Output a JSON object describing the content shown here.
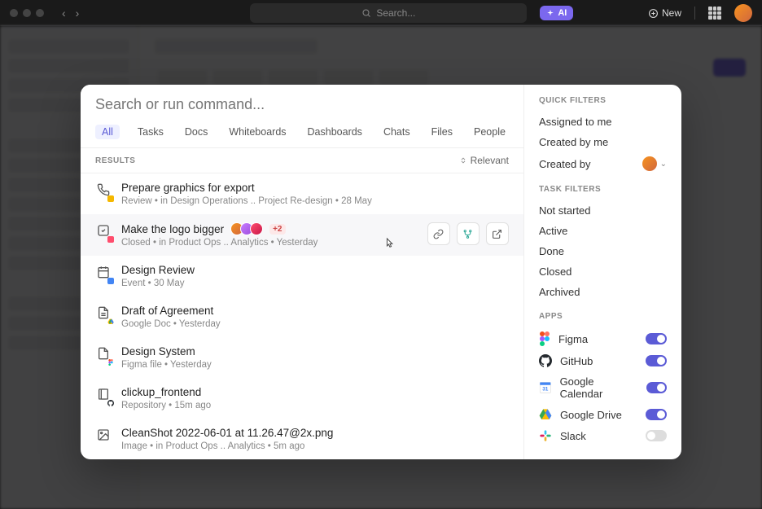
{
  "topbar": {
    "search_placeholder": "Search...",
    "ai_label": "AI",
    "new_label": "New"
  },
  "palette": {
    "search_placeholder": "Search or run command...",
    "tabs": [
      "All",
      "Tasks",
      "Docs",
      "Whiteboards",
      "Dashboards",
      "Chats",
      "Files",
      "People"
    ],
    "results_label": "RESULTS",
    "sort_label": "Relevant"
  },
  "results": [
    {
      "title": "Prepare graphics for export",
      "meta": "Review  •  in Design Operations ..   Project Re-design  •  28 May",
      "badge_color": "#f5b800"
    },
    {
      "title": "Make the logo bigger",
      "meta": "Closed  •  in Product Ops ..   Analytics  •  Yesterday",
      "extra_count": "+2",
      "badge_color": "#ff4d6d"
    },
    {
      "title": "Design Review",
      "meta": "Event  •  30 May"
    },
    {
      "title": "Draft of Agreement",
      "meta": "Google Doc  •  Yesterday"
    },
    {
      "title": "Design System",
      "meta": "Figma file  •  Yesterday"
    },
    {
      "title": "clickup_frontend",
      "meta": "Repository  •  15m ago"
    },
    {
      "title": "CleanShot 2022-06-01 at 11.26.47@2x.png",
      "meta": "Image  •  in Product Ops ..   Analytics  •  5m ago"
    }
  ],
  "sidebar": {
    "quick_filters_label": "QUICK FILTERS",
    "quick_filters": [
      "Assigned to me",
      "Created by me",
      "Created by"
    ],
    "task_filters_label": "TASK FILTERS",
    "task_filters": [
      "Not started",
      "Active",
      "Done",
      "Closed",
      "Archived"
    ],
    "apps_label": "APPS",
    "apps": [
      {
        "name": "Figma",
        "on": true
      },
      {
        "name": "GitHub",
        "on": true
      },
      {
        "name": "Google Calendar",
        "on": true
      },
      {
        "name": "Google Drive",
        "on": true
      },
      {
        "name": "Slack",
        "on": false
      }
    ]
  }
}
